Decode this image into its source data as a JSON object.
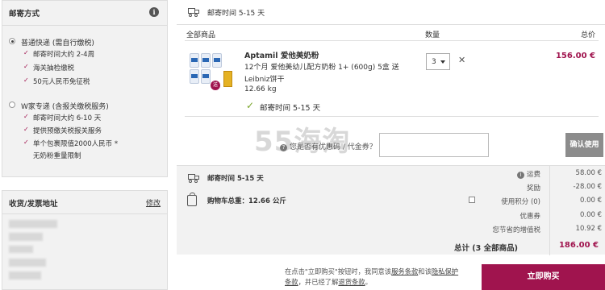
{
  "shipping": {
    "title": "邮寄方式",
    "options": [
      {
        "title": "普通快递 (需自行缴税)",
        "selected": true,
        "features": [
          "邮寄时间大约 2-4周",
          "海关抽检缴税",
          "50元人民币免征税"
        ]
      },
      {
        "title": "W家专递 (含报关缴税服务)",
        "selected": false,
        "features": [
          "邮寄时间大约 6-10 天",
          "提供预缴关税报关服务",
          "单个包裹限值2000人民币 *",
          "无奶粉重量限制"
        ]
      }
    ]
  },
  "address": {
    "title": "收货/发票地址",
    "edit_label": "修改"
  },
  "cart": {
    "delivery_time": "邮寄时间 5-15 天",
    "headers": {
      "items": "全部商品",
      "quantity": "数量",
      "total": "总价"
    },
    "item": {
      "name": "Aptamil 爱他美奶粉",
      "desc1": "12个月 爱他美幼儿配方奶粉 1+ (600g) 5盒 送",
      "desc2": "Leibniz饼干",
      "weight": "12.66 kg",
      "qty": "3",
      "price": "156.00 €",
      "delivery": "邮寄时间 5-15 天"
    },
    "coupon": {
      "question": "您是否有优惠码 / 代金券？",
      "button": "确认使用"
    },
    "watermark": "55海淘"
  },
  "summary": {
    "delivery_time": "邮寄时间 5-15 天",
    "weight_label": "购物车总重：12.66 公斤",
    "rows": [
      {
        "label": "运费",
        "value": "58.00 €"
      },
      {
        "label": "奖励",
        "value": "-28.00 €"
      },
      {
        "label": "使用积分 (0)",
        "value": "0.00 €"
      },
      {
        "label": "优惠券",
        "value": "0.00 €"
      },
      {
        "label": "您节省的增值税",
        "value": "10.92 €"
      }
    ],
    "total_label": "总计 (3 全部商品)",
    "total_value": "186.00 €"
  },
  "footer": {
    "text_a": "在点击\"立即购买\"按钮时，我同意该",
    "link_terms": "服务条款",
    "text_b": "和该",
    "link_privacy": "隐私保护",
    "link_privacy2": "条款",
    "text_c": "，并已经了解",
    "link_return": "退货条款",
    "text_d": "。",
    "buy_button": "立即购买"
  },
  "colors": {
    "accent": "#a0144e",
    "check_green": "#7aa52a"
  }
}
